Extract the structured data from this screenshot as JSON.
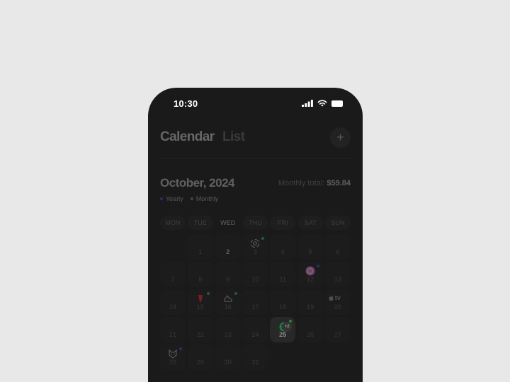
{
  "status": {
    "time": "10:30"
  },
  "header": {
    "tab_calendar": "Calendar",
    "tab_list": "List",
    "add_label": "+"
  },
  "month": {
    "title": "October, 2024",
    "total_label": "Monthly total:",
    "total_value": "$59.84"
  },
  "legend": [
    {
      "label": "Yearly",
      "color": "#3a3fa0"
    },
    {
      "label": "Monthly",
      "color": "#2c8f45"
    }
  ],
  "weekdays": [
    "MON",
    "TUE",
    "WED",
    "THU",
    "FRI",
    "SAT",
    "SUN"
  ],
  "active_weekday": "WED",
  "calendar": {
    "today": 2,
    "selected": 25,
    "overflow_badge": "+2",
    "appletv_text": "tv",
    "subscriptions": [
      {
        "day": 3,
        "icon": "openai-icon",
        "cycle": "monthly"
      },
      {
        "day": 12,
        "icon": "pink-orb-icon",
        "cycle": "yearly"
      },
      {
        "day": 15,
        "icon": "red-logo-icon",
        "cycle": "monthly"
      },
      {
        "day": 16,
        "icon": "shoe-icon",
        "cycle": "monthly"
      },
      {
        "day": 20,
        "icon": "apple-tv-icon",
        "cycle": "none"
      },
      {
        "day": 25,
        "icon": "spotify-icon",
        "cycle": "monthly"
      },
      {
        "day": 28,
        "icon": "cat-mask-icon",
        "cycle": "yearly"
      }
    ],
    "days": [
      "",
      "1",
      "2",
      "3",
      "4",
      "5",
      "6",
      "7",
      "8",
      "9",
      "10",
      "11",
      "12",
      "13",
      "14",
      "15",
      "16",
      "17",
      "18",
      "19",
      "20",
      "21",
      "22",
      "23",
      "24",
      "25",
      "26",
      "27",
      "28",
      "29",
      "30",
      "31"
    ]
  }
}
